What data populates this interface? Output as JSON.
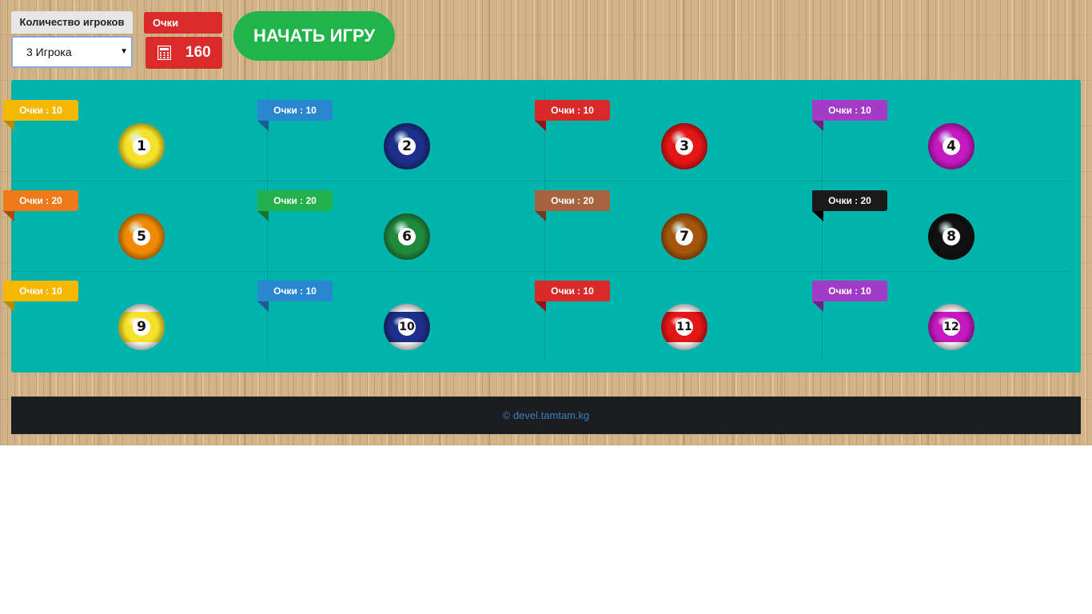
{
  "controls": {
    "players_label": "Количество игроков",
    "players_value": "3 Игрока",
    "score_label": "Очки",
    "score_value": "160",
    "start_button": "НАЧАТЬ ИГРУ"
  },
  "balls": [
    {
      "number": "1",
      "points_label": "Очки : 10",
      "ribbon_color": "#f5b800",
      "fold_color": "#b88a00",
      "ball_color": "#f6e12a",
      "striped": false
    },
    {
      "number": "2",
      "points_label": "Очки : 10",
      "ribbon_color": "#2b86d0",
      "fold_color": "#1a5b93",
      "ball_color": "#1d2f8a",
      "striped": false
    },
    {
      "number": "3",
      "points_label": "Очки : 10",
      "ribbon_color": "#d92a2a",
      "fold_color": "#8f1616",
      "ball_color": "#e41616",
      "striped": false
    },
    {
      "number": "4",
      "points_label": "Очки : 10",
      "ribbon_color": "#a33bc7",
      "fold_color": "#6d2186",
      "ball_color": "#c418c0",
      "striped": false
    },
    {
      "number": "5",
      "points_label": "Очки : 20",
      "ribbon_color": "#ef7a1a",
      "fold_color": "#a44f0c",
      "ball_color": "#f08a05",
      "striped": false
    },
    {
      "number": "6",
      "points_label": "Очки : 20",
      "ribbon_color": "#22b14c",
      "fold_color": "#157533",
      "ball_color": "#1f8a3c",
      "striped": false
    },
    {
      "number": "7",
      "points_label": "Очки : 20",
      "ribbon_color": "#a5643d",
      "fold_color": "#6a3e23",
      "ball_color": "#a4560c",
      "striped": false
    },
    {
      "number": "8",
      "points_label": "Очки : 20",
      "ribbon_color": "#1a1a1a",
      "fold_color": "#000000",
      "ball_color": "#111111",
      "striped": false
    },
    {
      "number": "9",
      "points_label": "Очки : 10",
      "ribbon_color": "#f5b800",
      "fold_color": "#b88a00",
      "ball_color": "#f6e12a",
      "striped": true
    },
    {
      "number": "10",
      "points_label": "Очки : 10",
      "ribbon_color": "#2b86d0",
      "fold_color": "#1a5b93",
      "ball_color": "#1d2f8a",
      "striped": true
    },
    {
      "number": "11",
      "points_label": "Очки : 10",
      "ribbon_color": "#d92a2a",
      "fold_color": "#8f1616",
      "ball_color": "#e41616",
      "striped": true
    },
    {
      "number": "12",
      "points_label": "Очки : 10",
      "ribbon_color": "#a33bc7",
      "fold_color": "#6d2186",
      "ball_color": "#c418c0",
      "striped": true
    }
  ],
  "footer": {
    "text": "©  devel.tamtam.kg"
  }
}
